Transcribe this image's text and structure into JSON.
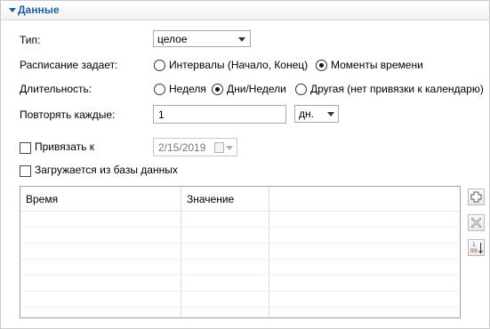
{
  "section": {
    "title": "Данные"
  },
  "type_row": {
    "label": "Тип:",
    "value": "целое"
  },
  "schedule_row": {
    "label": "Расписание задает:",
    "options": [
      {
        "label": "Интервалы (Начало, Конец)",
        "selected": false
      },
      {
        "label": "Моменты времени",
        "selected": true
      }
    ]
  },
  "duration_row": {
    "label": "Длительность:",
    "options": [
      {
        "label": "Неделя",
        "selected": false
      },
      {
        "label": "Дни/Недели",
        "selected": true
      },
      {
        "label": "Другая (нет привязки к календарю)",
        "selected": false
      }
    ]
  },
  "repeat_row": {
    "label": "Повторять каждые:",
    "value": "1",
    "unit": "дн."
  },
  "bind_row": {
    "label": "Привязать к",
    "checked": false,
    "date": "2/15/2019"
  },
  "db_row": {
    "label": "Загружается из базы данных",
    "checked": false
  },
  "table": {
    "columns": [
      "Время",
      "Значение",
      ""
    ],
    "rows": []
  },
  "side_buttons": [
    {
      "icon": "add-row-icon"
    },
    {
      "icon": "delete-row-icon"
    },
    {
      "icon": "sort-icon",
      "label_top": "1",
      "label_bottom": "99"
    }
  ]
}
